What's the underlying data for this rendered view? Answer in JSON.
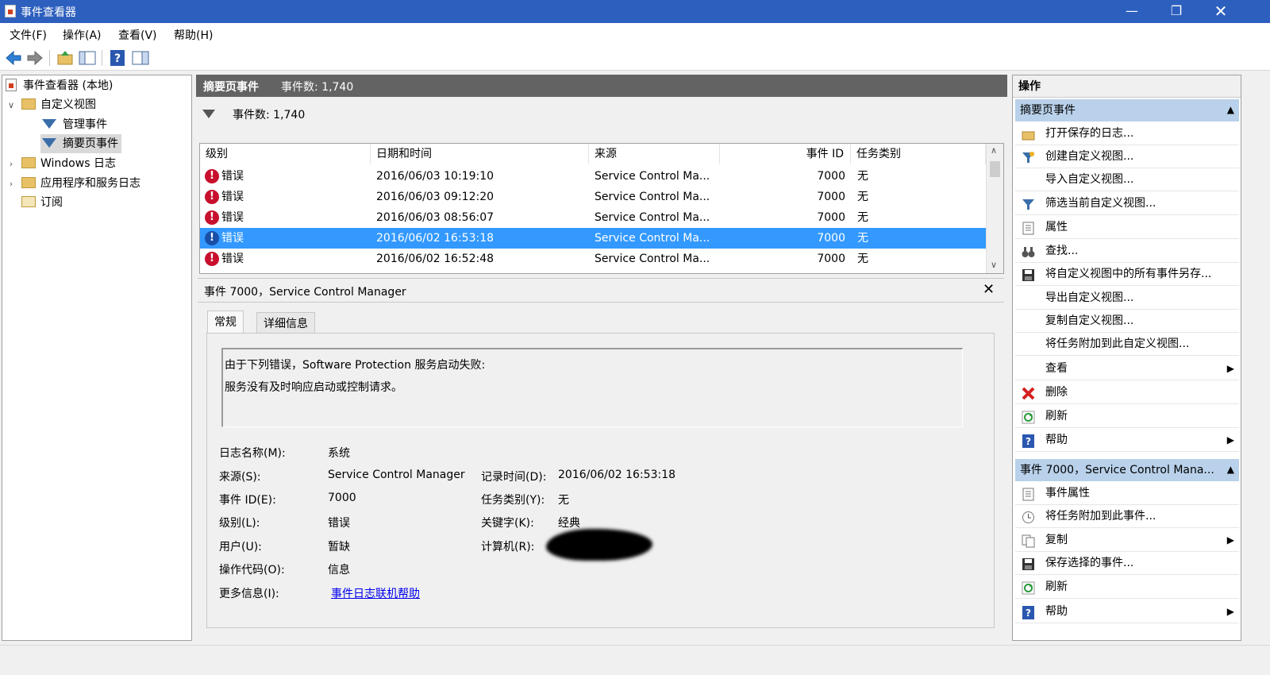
{
  "window": {
    "title": "事件查看器"
  },
  "menu": [
    "文件(F)",
    "操作(A)",
    "查看(V)",
    "帮助(H)"
  ],
  "tree": {
    "root": "事件查看器 (本地)",
    "custom_views": "自定义视图",
    "admin_events": "管理事件",
    "summary_events": "摘要页事件",
    "windows_logs": "Windows 日志",
    "app_service_logs": "应用程序和服务日志",
    "subscriptions": "订阅"
  },
  "middle": {
    "header_title": "摘要页事件",
    "header_count": "事件数: 1,740",
    "filter_count": "事件数: 1,740"
  },
  "grid": {
    "columns": [
      "级别",
      "日期和时间",
      "来源",
      "事件 ID",
      "任务类别"
    ],
    "rows": [
      {
        "level": "错误",
        "datetime": "2016/06/03 10:19:10",
        "source": "Service Control Ma...",
        "event_id": "7000",
        "task": "无"
      },
      {
        "level": "错误",
        "datetime": "2016/06/03 09:12:20",
        "source": "Service Control Ma...",
        "event_id": "7000",
        "task": "无"
      },
      {
        "level": "错误",
        "datetime": "2016/06/03 08:56:07",
        "source": "Service Control Ma...",
        "event_id": "7000",
        "task": "无"
      },
      {
        "level": "错误",
        "datetime": "2016/06/02 16:53:18",
        "source": "Service Control Ma...",
        "event_id": "7000",
        "task": "无"
      },
      {
        "level": "错误",
        "datetime": "2016/06/02 16:52:48",
        "source": "Service Control Ma...",
        "event_id": "7000",
        "task": "无"
      }
    ]
  },
  "detail": {
    "title": "事件 7000，Service Control Manager",
    "tabs": [
      "常规",
      "详细信息"
    ],
    "description_line1": "由于下列错误，Software Protection 服务启动失败:",
    "description_line2": "服务没有及时响应启动或控制请求。",
    "labels": {
      "log_name": "日志名称(M):",
      "source": "来源(S):",
      "event_id": "事件 ID(E):",
      "level": "级别(L):",
      "user": "用户(U):",
      "opcode": "操作代码(O):",
      "more_info": "更多信息(I):",
      "logged": "记录时间(D):",
      "task_category": "任务类别(Y):",
      "keywords": "关键字(K):",
      "computer": "计算机(R):"
    },
    "values": {
      "log_name": "系统",
      "source": "Service Control Manager",
      "event_id": "7000",
      "level": "错误",
      "user": "暂缺",
      "opcode": "信息",
      "more_info": "事件日志联机帮助",
      "logged": "2016/06/02 16:53:18",
      "task_category": "无",
      "keywords": "经典"
    }
  },
  "actions": {
    "title": "操作",
    "section1": "摘要页事件",
    "items1": [
      "打开保存的日志...",
      "创建自定义视图...",
      "导入自定义视图...",
      "筛选当前自定义视图...",
      "属性",
      "查找...",
      "将自定义视图中的所有事件另存...",
      "导出自定义视图...",
      "复制自定义视图...",
      "将任务附加到此自定义视图...",
      "查看",
      "删除",
      "刷新",
      "帮助"
    ],
    "section2": "事件 7000，Service Control Mana...",
    "items2": [
      "事件属性",
      "将任务附加到此事件...",
      "复制",
      "保存选择的事件...",
      "刷新",
      "帮助"
    ]
  }
}
